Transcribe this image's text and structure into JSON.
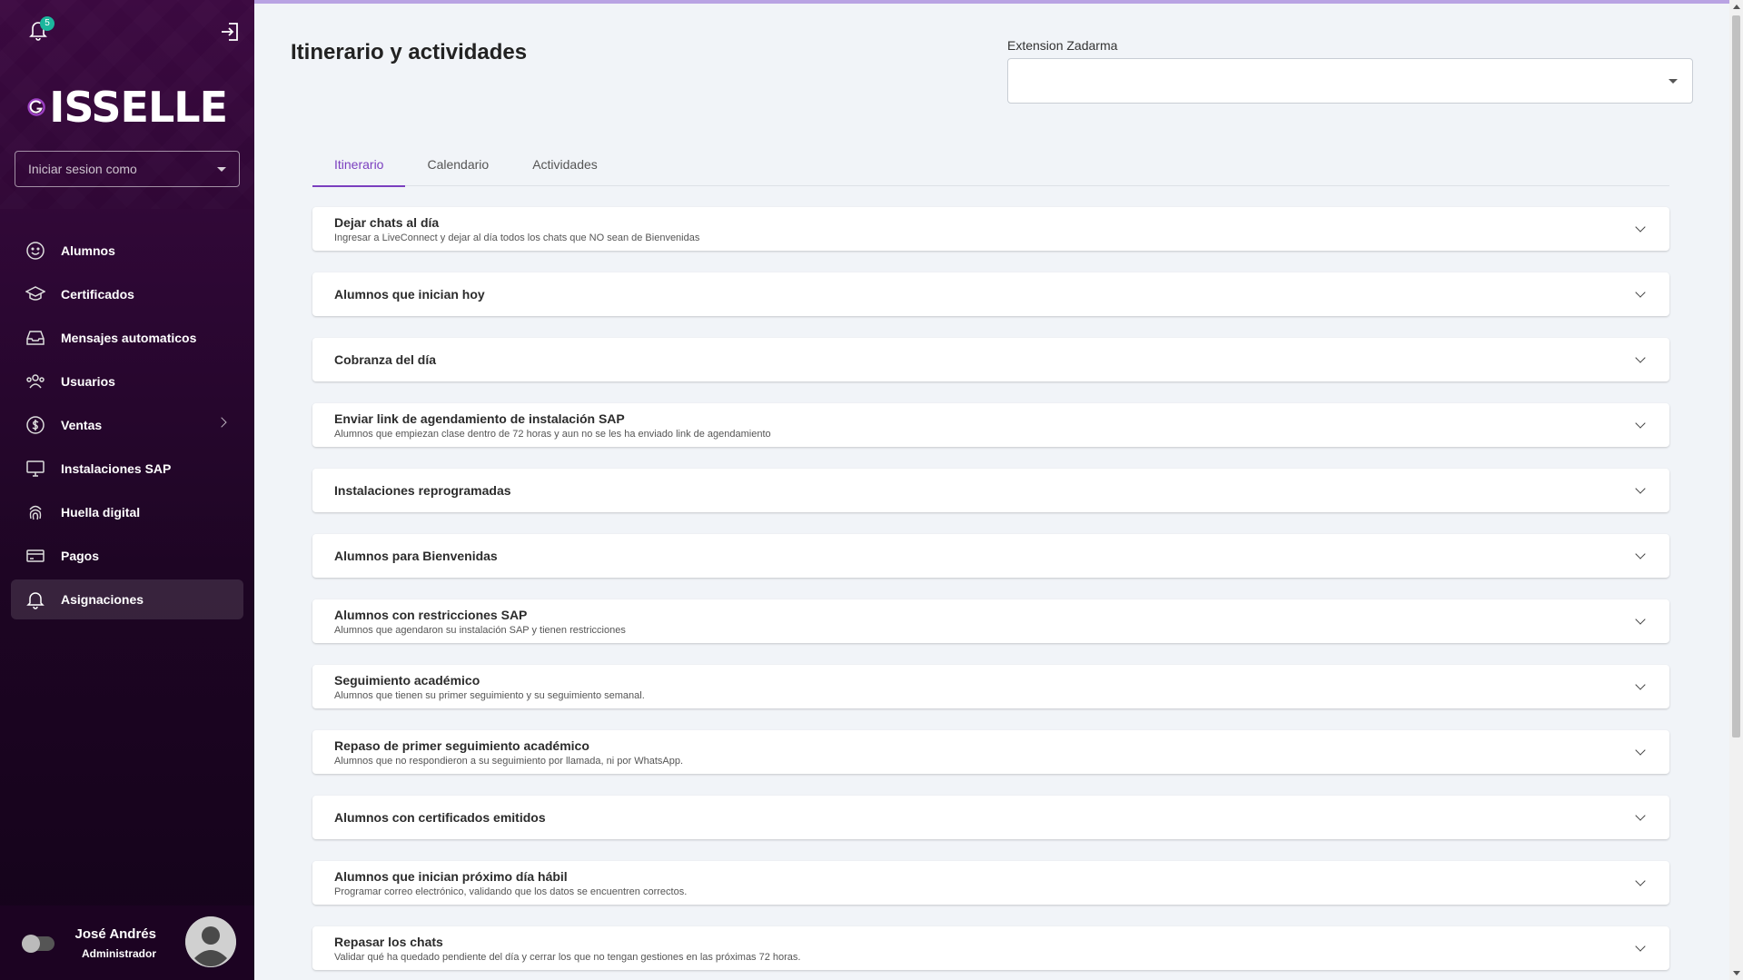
{
  "sidebar": {
    "notifications_count": "5",
    "logo_text": "ISSELLE",
    "login_select_placeholder": "Iniciar sesion como",
    "items": [
      {
        "label": "Alumnos",
        "icon": "smile-icon"
      },
      {
        "label": "Certificados",
        "icon": "graduation-cap-icon"
      },
      {
        "label": "Mensajes automaticos",
        "icon": "inbox-icon"
      },
      {
        "label": "Usuarios",
        "icon": "users-icon"
      },
      {
        "label": "Ventas",
        "icon": "dollar-icon"
      },
      {
        "label": "Instalaciones SAP",
        "icon": "monitor-icon"
      },
      {
        "label": "Huella digital",
        "icon": "fingerprint-icon"
      },
      {
        "label": "Pagos",
        "icon": "credit-card-icon"
      },
      {
        "label": "Asignaciones",
        "icon": "bell-icon"
      }
    ],
    "profile": {
      "name": "José Andrés",
      "role": "Administrador"
    }
  },
  "main": {
    "title": "Itinerario y actividades",
    "extension_label": "Extension Zadarma",
    "extension_value": "",
    "tabs": [
      {
        "label": "Itinerario"
      },
      {
        "label": "Calendario"
      },
      {
        "label": "Actividades"
      }
    ],
    "items": [
      {
        "title": "Dejar chats al día",
        "subtitle": "Ingresar a LiveConnect y dejar al día todos los chats que NO sean de Bienvenidas"
      },
      {
        "title": "Alumnos que inician hoy",
        "subtitle": ""
      },
      {
        "title": "Cobranza del día",
        "subtitle": ""
      },
      {
        "title": "Enviar link de agendamiento de instalación SAP",
        "subtitle": "Alumnos que empiezan clase dentro de 72 horas y aun no se les ha enviado link de agendamiento"
      },
      {
        "title": "Instalaciones reprogramadas",
        "subtitle": ""
      },
      {
        "title": "Alumnos para Bienvenidas",
        "subtitle": ""
      },
      {
        "title": "Alumnos con restricciones SAP",
        "subtitle": "Alumnos que agendaron su instalación SAP y tienen restricciones"
      },
      {
        "title": "Seguimiento académico",
        "subtitle": "Alumnos que tienen su primer seguimiento y su seguimiento semanal."
      },
      {
        "title": "Repaso de primer seguimiento académico",
        "subtitle": "Alumnos que no respondieron a su seguimiento por llamada, ni por WhatsApp."
      },
      {
        "title": "Alumnos con certificados emitidos",
        "subtitle": ""
      },
      {
        "title": "Alumnos que inician próximo día hábil",
        "subtitle": "Programar correo electrónico, validando que los datos se encuentren correctos."
      },
      {
        "title": "Repasar los chats",
        "subtitle": "Validar qué ha quedado pendiente del día y cerrar los que no tengan gestiones en las próximas 72 horas."
      }
    ]
  },
  "colors": {
    "accent": "#7b3fbf",
    "sidebar_bg": "#2c0733",
    "badge": "#1bb69d"
  }
}
